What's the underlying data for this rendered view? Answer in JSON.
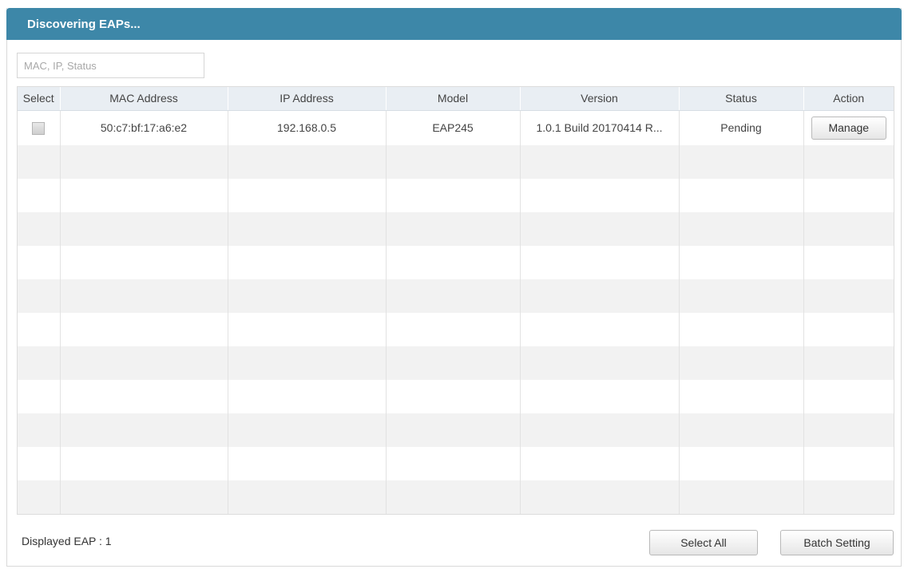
{
  "dialog": {
    "title": "Discovering EAPs..."
  },
  "search": {
    "placeholder": "MAC, IP, Status",
    "value": ""
  },
  "table": {
    "columns": [
      "Select",
      "MAC Address",
      "IP Address",
      "Model",
      "Version",
      "Status",
      "Action"
    ],
    "rows": [
      {
        "mac": "50:c7:bf:17:a6:e2",
        "ip": "192.168.0.5",
        "model": "EAP245",
        "version": "1.0.1 Build 20170414 R...",
        "status": "Pending",
        "action_label": "Manage"
      }
    ]
  },
  "footer": {
    "count_text": "Displayed EAP : 1",
    "select_all_label": "Select All",
    "batch_setting_label": "Batch Setting"
  },
  "colors": {
    "titlebar": "#3d87a8",
    "header_bg": "#e9eef3",
    "alt_row": "#f2f2f2"
  }
}
